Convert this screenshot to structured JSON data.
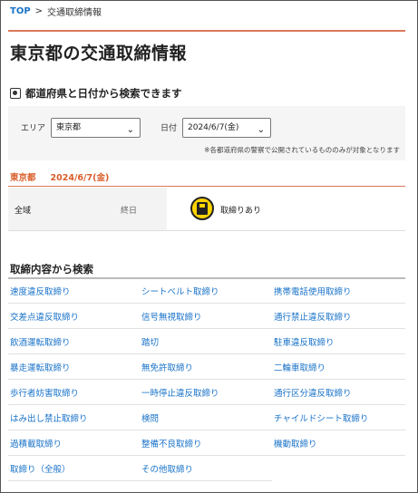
{
  "breadcrumb": {
    "top": "TOP",
    "separator": ">",
    "current": "交通取締情報"
  },
  "page_title": "東京都の交通取締情報",
  "search_section": {
    "heading": "都道府県と日付から検索できます",
    "area_label": "エリア",
    "area_value": "東京都",
    "date_label": "日付",
    "date_value": "2024/6/7(金)",
    "note": "※各都道府県の警察で公開されているもののみが対象となります"
  },
  "result": {
    "area": "東京都",
    "date": "2024/6/7(金)",
    "rows": [
      {
        "area": "全域",
        "time": "終日",
        "status": "取締りあり"
      }
    ]
  },
  "categories": {
    "title": "取締内容から検索",
    "items": [
      "速度違反取締り",
      "シートベルト取締り",
      "携帯電話使用取締り",
      "交差点違反取締り",
      "信号無視取締り",
      "通行禁止違反取締り",
      "飲酒運転取締り",
      "踏切",
      "駐車違反取締り",
      "暴走運転取締り",
      "無免許取締り",
      "二輪車取締り",
      "歩行者妨害取締り",
      "一時停止違反取締り",
      "通行区分違反取締り",
      "はみ出し禁止取締り",
      "検問",
      "チャイルドシート取締り",
      "過積載取締り",
      "整備不良取締り",
      "機動取締り",
      "取締り（全般）",
      "その他取締り"
    ]
  },
  "colors": {
    "accent": "#d9795a",
    "link": "#1a73c8",
    "badge": "#ffd400"
  },
  "icons": {
    "section": "search-icon",
    "select": "chevron-down-icon",
    "badge": "police-icon"
  }
}
